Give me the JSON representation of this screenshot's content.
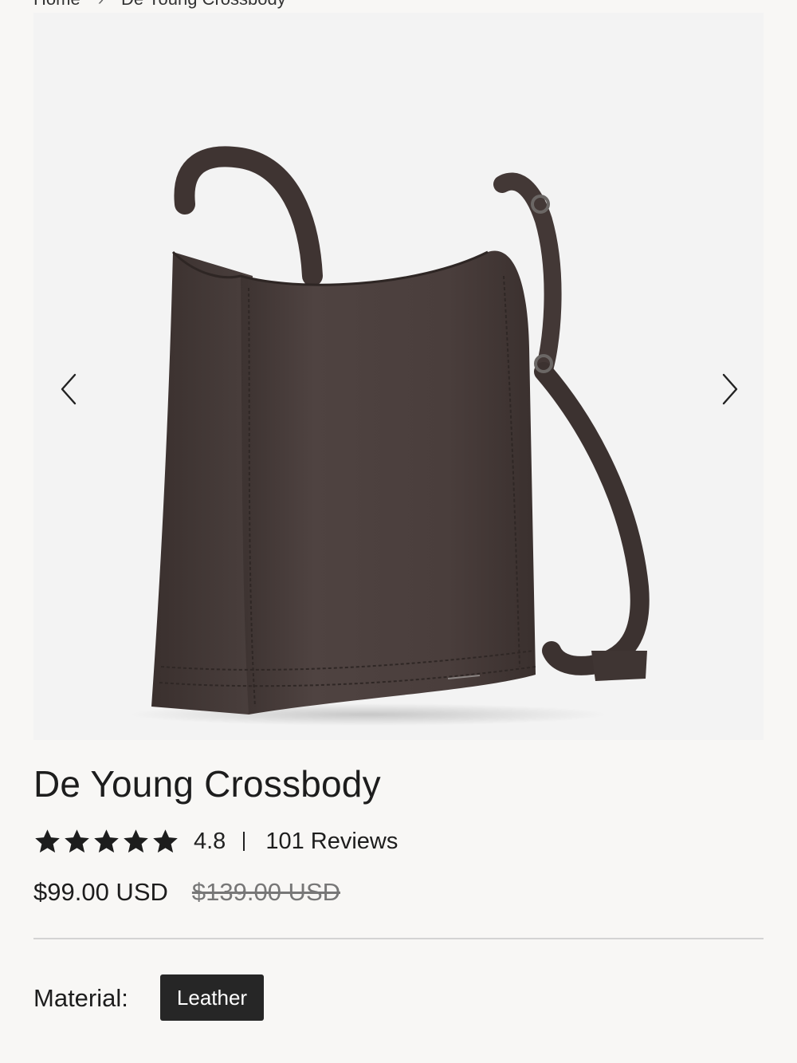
{
  "breadcrumb": {
    "home": "Home",
    "current": "De Young Crossbody"
  },
  "gallery": {
    "prev_icon": "chevron-left-icon",
    "next_icon": "chevron-right-icon",
    "image_alt": "product-image"
  },
  "product": {
    "title": "De Young Crossbody",
    "rating": "4.8",
    "rating_stars": 5,
    "reviews_label": "101 Reviews",
    "price_current": "$99.00 USD",
    "price_original": "$139.00 USD"
  },
  "options": {
    "material_label": "Material:",
    "material_selected": "Leather"
  },
  "colors": {
    "background": "#f8f7f5",
    "gallery_bg": "#f3f3f3",
    "bag_leather": "#4a3e3c",
    "text": "#1d1d1d",
    "selected_option_bg": "#262626"
  }
}
